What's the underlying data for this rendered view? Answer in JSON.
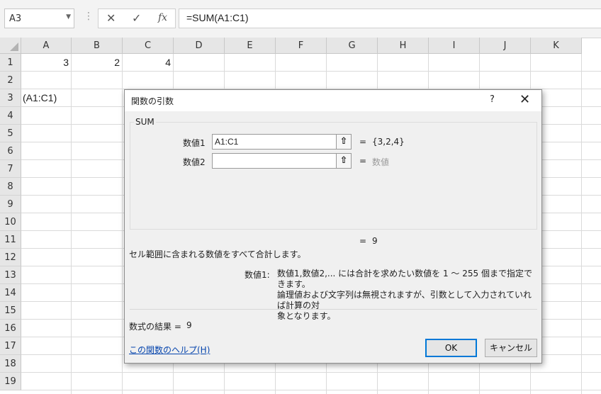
{
  "formula_bar": {
    "name_box": "A3",
    "cancel_icon": "✕",
    "enter_icon": "✓",
    "fx_label": "fx",
    "formula": "=SUM(A1:C1)"
  },
  "columns": [
    "A",
    "B",
    "C",
    "D",
    "E",
    "F",
    "G",
    "H",
    "I",
    "J",
    "K"
  ],
  "rows": [
    "1",
    "2",
    "3",
    "4",
    "5",
    "6",
    "7",
    "8",
    "9",
    "10",
    "11",
    "12",
    "13",
    "14",
    "15",
    "16",
    "17",
    "18",
    "19"
  ],
  "cells": {
    "A1": "3",
    "B1": "2",
    "C1": "4",
    "A3": "(A1:C1)"
  },
  "dialog": {
    "title": "関数の引数",
    "help_btn": "?",
    "close_btn": "✕",
    "function_name": "SUM",
    "args": [
      {
        "label": "数値1",
        "value": "A1:C1",
        "eq": "=",
        "result": "{3,2,4}"
      },
      {
        "label": "数値2",
        "value": "",
        "eq": "=",
        "result": "数値"
      }
    ],
    "result_eq": "=",
    "result_value": "9",
    "description": "セル範囲に含まれる数値をすべて合計します。",
    "arg_desc_label": "数値1:",
    "arg_desc_line1": "数値1,数値2,... には合計を求めたい数値を 1 ～ 255 個まで指定できます。",
    "arg_desc_line2": "論理値および文字列は無視されますが、引数として入力されていれば計算の対",
    "arg_desc_line3": "象となります。",
    "formula_result_label": "数式の結果 =",
    "formula_result_value": "9",
    "help_link": "この関数のヘルプ(H)",
    "ok_label": "OK",
    "cancel_label": "キャンセル"
  }
}
